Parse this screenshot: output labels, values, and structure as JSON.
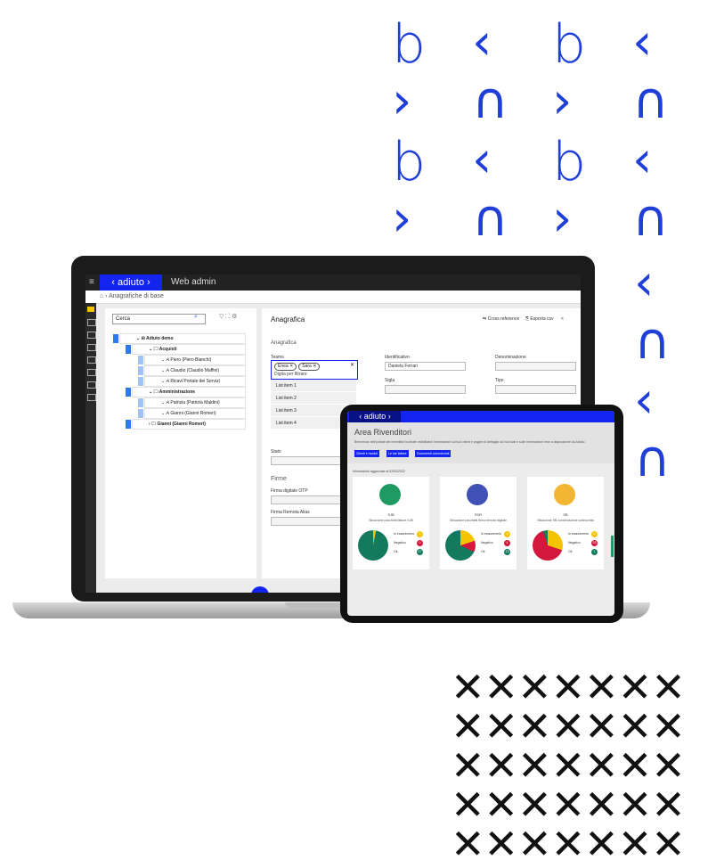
{
  "decor": {
    "glyph_rows": [
      [
        "b",
        "‹",
        "b",
        "‹"
      ],
      [
        "›",
        "∩",
        "›",
        "∩"
      ],
      [
        "b",
        "‹",
        "b",
        "‹"
      ],
      [
        "›",
        "∩",
        "›",
        "∩"
      ]
    ],
    "glyph_column": [
      "‹",
      "∩",
      "‹",
      "∩"
    ],
    "x_rows": [
      "✕✕✕✕✕✕✕",
      "✕✕✕✕✕✕✕",
      "✕✕✕✕✕✕✕",
      "✕✕✕✕✕✕✕",
      "✕✕✕✕✕✕✕"
    ],
    "accent": "#1f3fd8"
  },
  "laptop": {
    "app": {
      "menu_icon": "≡",
      "brand": "‹ adiuto ›",
      "subtitle": "Web admin"
    },
    "breadcrumb": "⌂ › Anagrafiche di base",
    "tree": {
      "search_placeholder": "Cerca",
      "search_icon": "⌕",
      "tool_icons": "▽ ⛶ ⚙",
      "rows": [
        {
          "label": "⌄ ⊟ Adiuto demo",
          "indent": 0,
          "bold": true
        },
        {
          "label": "⌄ 🗀 Acquisti",
          "indent": 1,
          "bold": true
        },
        {
          "label": "⌄ 𝘈 Piero (Piero Bianchi)",
          "indent": 2,
          "bold": false
        },
        {
          "label": "⌄ 𝘈 Claudio (Claudio Maffini)",
          "indent": 2,
          "bold": false
        },
        {
          "label": "⌄ 𝘈 Ricavi Portale dei Servizi",
          "indent": 2,
          "bold": false
        },
        {
          "label": "⌄ 🗀 Amministrazione",
          "indent": 1,
          "bold": true
        },
        {
          "label": "⌄ 𝘈 Patrizia (Patrizia Maldini)",
          "indent": 2,
          "bold": false
        },
        {
          "label": "⌄ 𝘈 Gianni (Gianni Romeri)",
          "indent": 2,
          "bold": false
        },
        {
          "label": "› 🗀 Gianni (Gianni Romeri)",
          "indent": 1,
          "bold": true
        }
      ],
      "fab": "+"
    },
    "detail": {
      "title": "Anagrafica",
      "actions": [
        "⇆ Cross reference",
        "⎘ Esporta csv",
        "<"
      ],
      "section": "Anagrafica",
      "teams_label": "Teams",
      "chips": [
        "Enea ✕",
        "Sara ✕"
      ],
      "filter_placeholder": "Digita per filtrare",
      "list_items": [
        "List item 1",
        "List item 2",
        "List item 3",
        "List item 4"
      ],
      "identificativo_label": "Identificativo",
      "identificativo_value": "Daniela Ferrari",
      "denominazione_label": "Denominazione",
      "sigla_label": "Sigla",
      "tipo_label": "Tipo",
      "stato_label": "Stato",
      "firme_section": "Firme",
      "firma_otp_label": "Firma digitale OTP",
      "firma_remota_label": "Firma Remota Alias"
    }
  },
  "tablet": {
    "brand": "‹ adiuto ›",
    "area_title": "Area Rivenditori",
    "area_desc": "Benvenuto nell'portale dei rivenditori Inoltrate visibilitatori Informazioni sui tuoi clienti e pagine di dettaglio sui tuoi dati e sulle informazioni rese a disposizione da Adiuto.",
    "buttons": [
      "Clienti e moduli",
      "Le tue fatture",
      "Documenti commerciali"
    ],
    "updated": "Informazioni aggiornate al 02/03/2022",
    "cards": [
      {
        "code": "SJB",
        "caption": "Situazione pacchetti fatture SJB",
        "icon_color": "#1e9a62",
        "pie": [
          {
            "label": "In esaurimento",
            "value": 3,
            "color": "#f5c400"
          },
          {
            "label": "Negativo",
            "value": 0,
            "color": "#d4183d"
          },
          {
            "label": "Ok",
            "value": 97,
            "color": "#137a5e"
          }
        ],
        "counts": [
          "3",
          "0",
          "27"
        ]
      },
      {
        "code": "FDR",
        "caption": "Situazione pacchetti firma remota digitale",
        "icon_color": "#3f51b5",
        "pie": [
          {
            "label": "In esaurimento",
            "value": 20,
            "color": "#f5c400"
          },
          {
            "label": "Negativo",
            "value": 12,
            "color": "#d4183d"
          },
          {
            "label": "Ok",
            "value": 68,
            "color": "#137a5e"
          }
        ],
        "counts": [
          "3",
          "4",
          "13"
        ]
      },
      {
        "code": "SB",
        "caption": "Situazione SB conservazione sottoscritta",
        "icon_color": "#f2b632",
        "pie": [
          {
            "label": "In esaurimento",
            "value": 30,
            "color": "#f5c400"
          },
          {
            "label": "Negativo",
            "value": 65,
            "color": "#d4183d"
          },
          {
            "label": "Ok",
            "value": 5,
            "color": "#137a5e"
          }
        ],
        "counts": [
          "11",
          "23",
          "1"
        ]
      }
    ],
    "legend": [
      "In esaurimento",
      "Negativo",
      "Ok"
    ]
  }
}
